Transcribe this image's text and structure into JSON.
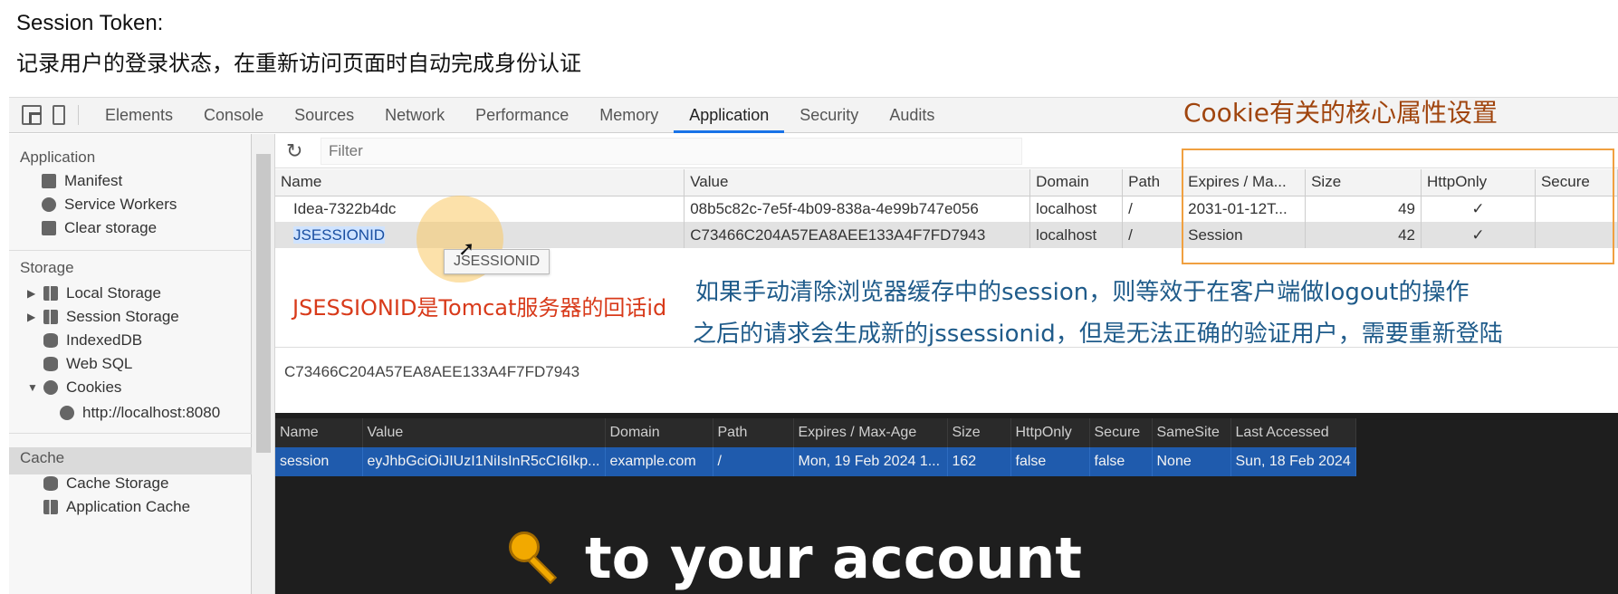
{
  "slide": {
    "title": "Session Token:",
    "subtitle": "记录用户的登录状态，在重新访问页面时自动完成身份认证"
  },
  "devtools": {
    "tabs": [
      "Elements",
      "Console",
      "Sources",
      "Network",
      "Performance",
      "Memory",
      "Application",
      "Security",
      "Audits"
    ],
    "active_tab": "Application"
  },
  "annotations": {
    "cookie_props": "Cookie有关的核心属性设置",
    "jsessionid_note": "JSESSIONID是Tomcat服务器的回话id",
    "blue_line1": "如果手动清除浏览器缓存中的session，则等效于在客户端做logout的操作",
    "blue_line2": "之后的请求会生成新的jssessionid，但是无法正确的验证用户，需要重新登陆"
  },
  "sidebar": {
    "application_header": "Application",
    "application_items": [
      "Manifest",
      "Service Workers",
      "Clear storage"
    ],
    "storage_header": "Storage",
    "storage_items": [
      "Local Storage",
      "Session Storage",
      "IndexedDB",
      "Web SQL",
      "Cookies"
    ],
    "cookie_origin": "http://localhost:8080",
    "cache_header": "Cache",
    "cache_items": [
      "Cache Storage",
      "Application Cache"
    ]
  },
  "filter": {
    "placeholder": "Filter"
  },
  "cookie_table": {
    "headers": [
      "Name",
      "Value",
      "Domain",
      "Path",
      "Expires / Ma...",
      "Size",
      "HttpOnly",
      "Secure"
    ],
    "rows": [
      {
        "name": "Idea-7322b4dc",
        "value": "08b5c82c-7e5f-4b09-838a-4e99b747e056",
        "domain": "localhost",
        "path": "/",
        "expires": "2031-01-12T...",
        "size": "49",
        "httponly": "✓",
        "secure": ""
      },
      {
        "name": "JSESSIONID",
        "value": "C73466C204A57EA8AEE133A4F7FD7943",
        "domain": "localhost",
        "path": "/",
        "expires": "Session",
        "size": "42",
        "httponly": "✓",
        "secure": ""
      }
    ]
  },
  "tooltip": "JSESSIONID",
  "value_preview": "C73466C204A57EA8AEE133A4F7FD7943",
  "dark_table": {
    "headers": [
      "Name",
      "Value",
      "Domain",
      "Path",
      "Expires / Max-Age",
      "Size",
      "HttpOnly",
      "Secure",
      "SameSite",
      "Last Accessed"
    ],
    "row": [
      "session",
      "eyJhbGciOiJIUzI1NiIsInR5cCI6Ikp...",
      "example.com",
      "/",
      "Mon, 19 Feb 2024 1...",
      "162",
      "false",
      "false",
      "None",
      "Sun, 18 Feb 2024"
    ]
  },
  "headline": "to your account",
  "icons": [
    "inspect-icon",
    "device-icon",
    "refresh-icon",
    "key-icon"
  ]
}
